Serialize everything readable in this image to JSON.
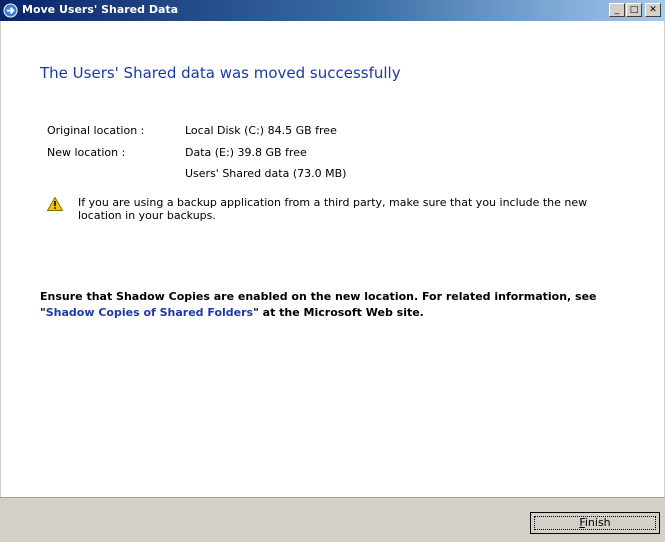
{
  "window": {
    "title": "Move Users' Shared Data",
    "minimize_glyph": "_",
    "maximize_glyph": "□",
    "close_glyph": "✕"
  },
  "main": {
    "heading": "The Users' Shared data was moved successfully",
    "original_location_label": "Original location :",
    "original_location_value": "Local Disk (C:) 84.5 GB free",
    "new_location_label": "New location :",
    "new_location_value": "Data (E:) 39.8 GB free",
    "new_location_detail": "Users' Shared data (73.0 MB)",
    "warning_text": "If you are using a backup application from a third party, make sure that you include the new location in your backups.",
    "shadow_text_before": "Ensure that Shadow Copies are enabled on the new location. For related information, see \"",
    "shadow_link": "Shadow Copies of Shared Folders",
    "shadow_text_after": "\" at the Microsoft Web site."
  },
  "footer": {
    "finish_accel": "F",
    "finish_rest": "inish"
  },
  "icons": {
    "title_icon": "arrow-right-circle-icon",
    "warning_icon": "warning-triangle-icon"
  },
  "colors": {
    "heading": "#1a3aa3",
    "titlebar_start": "#0a246a",
    "titlebar_end": "#a6caf0",
    "footer_bg": "#d4d0c8",
    "warning_yellow": "#f5c400"
  }
}
